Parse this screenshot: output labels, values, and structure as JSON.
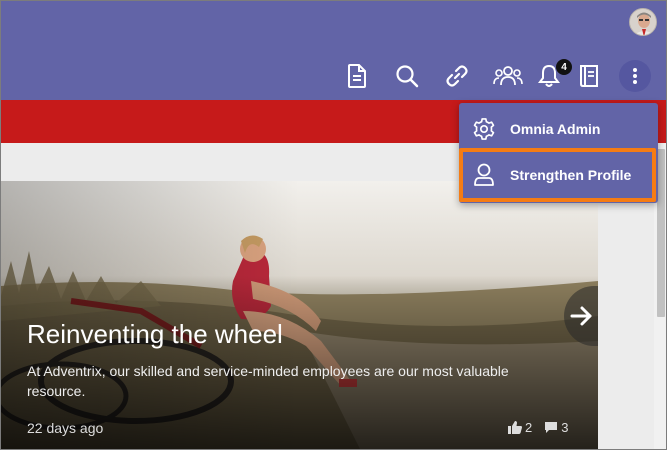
{
  "header": {
    "icons": [
      "document-icon",
      "search-icon",
      "link-icon",
      "people-icon",
      "bell-icon",
      "book-icon",
      "more-icon"
    ],
    "notification_count": "4",
    "accent_color": "#6264a7",
    "brand_red": "#c61a1a"
  },
  "menu": {
    "items": [
      {
        "label": "Omnia Admin",
        "icon": "gear-icon"
      },
      {
        "label": "Strengthen Profile",
        "icon": "user-icon"
      }
    ],
    "highlight_color": "#f57c14"
  },
  "hero": {
    "title": "Reinventing the wheel",
    "description": "At Adventrix, our skilled and service-minded employees are our most valuable resource.",
    "date": "22 days ago",
    "likes": "2",
    "comments": "3"
  }
}
